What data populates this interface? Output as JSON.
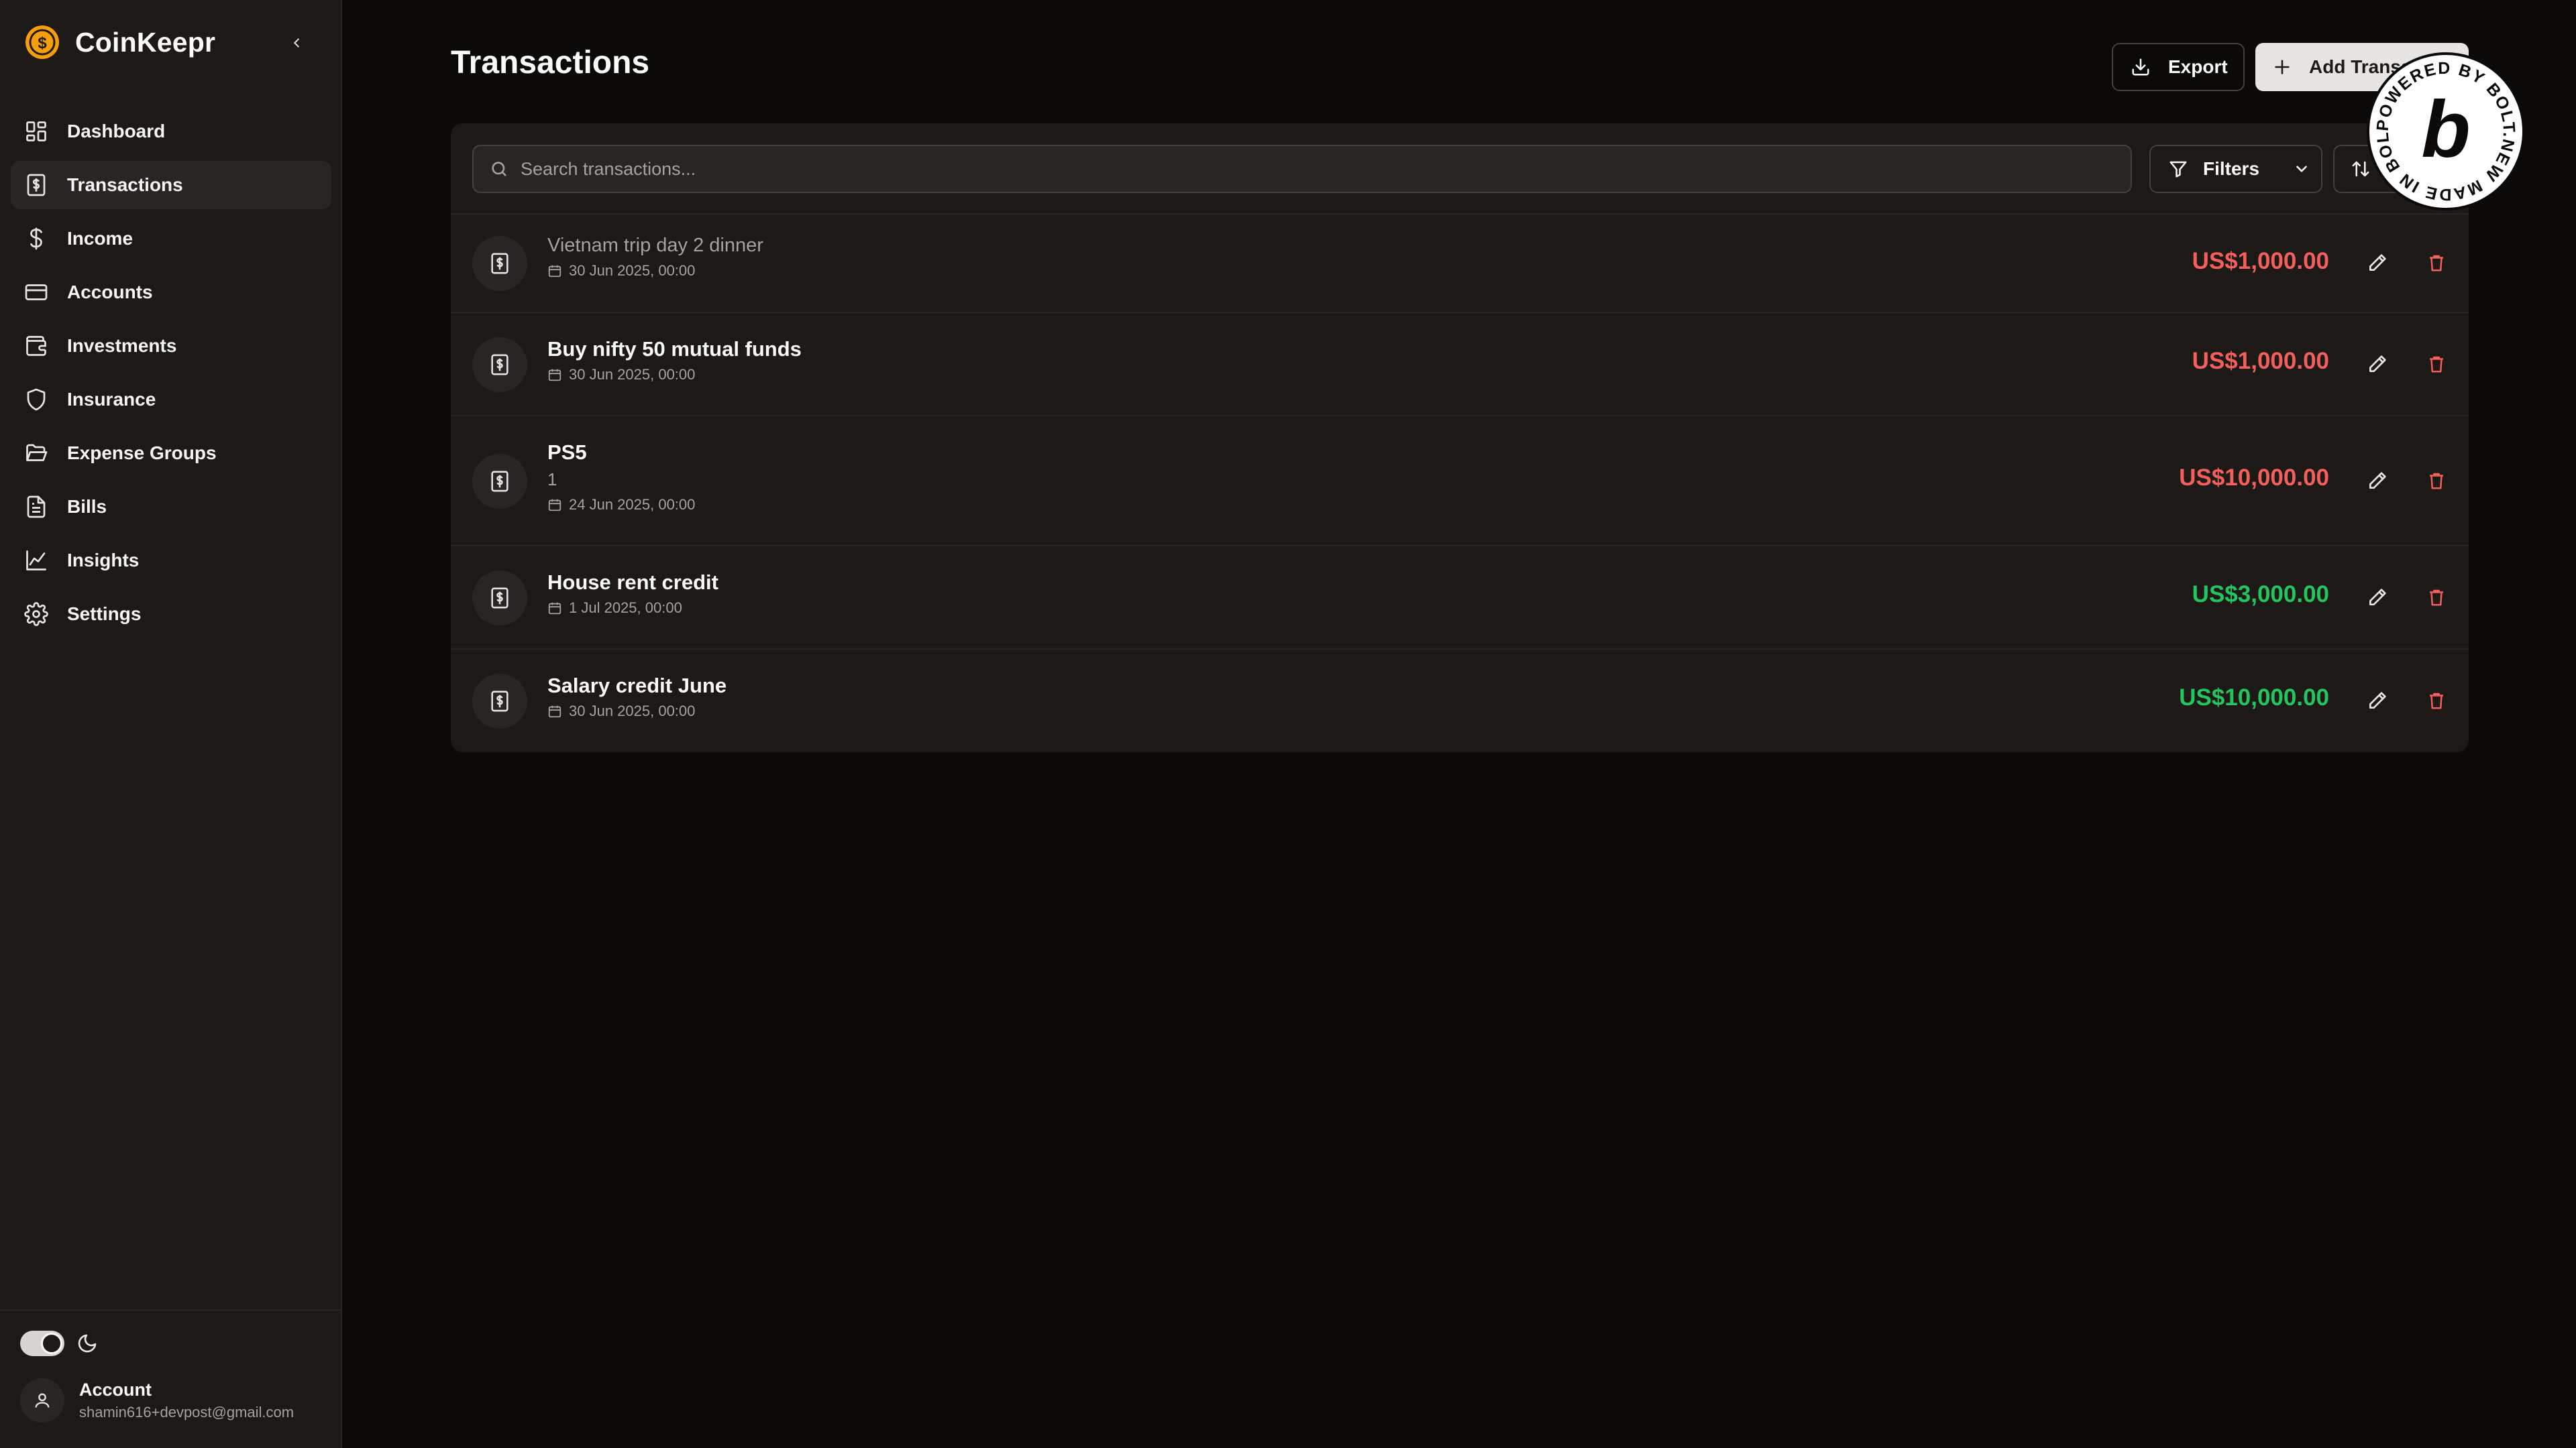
{
  "app": {
    "name": "CoinKeepr"
  },
  "sidebar": {
    "items": [
      {
        "label": "Dashboard",
        "icon": "dashboard-icon",
        "active": false
      },
      {
        "label": "Transactions",
        "icon": "receipt-dollar-icon",
        "active": true
      },
      {
        "label": "Income",
        "icon": "dollar-sign-icon",
        "active": false
      },
      {
        "label": "Accounts",
        "icon": "credit-card-icon",
        "active": false
      },
      {
        "label": "Investments",
        "icon": "wallet-icon",
        "active": false
      },
      {
        "label": "Insurance",
        "icon": "shield-icon",
        "active": false
      },
      {
        "label": "Expense Groups",
        "icon": "folder-open-icon",
        "active": false
      },
      {
        "label": "Bills",
        "icon": "file-text-icon",
        "active": false
      },
      {
        "label": "Insights",
        "icon": "line-chart-icon",
        "active": false
      },
      {
        "label": "Settings",
        "icon": "gear-icon",
        "active": false
      }
    ],
    "account": {
      "name": "Account",
      "email": "shamin616+devpost@gmail.com"
    },
    "theme": "dark"
  },
  "header": {
    "title": "Transactions",
    "export_label": "Export",
    "add_label": "Add Transaction"
  },
  "toolbar": {
    "search_placeholder": "Search transactions...",
    "filters_label": "Filters"
  },
  "transactions": [
    {
      "title": "Vietnam trip day 2 dinner",
      "note": "",
      "date": "30 Jun 2025, 00:00",
      "amount": "US$1,000.00",
      "type": "debit",
      "muted": true
    },
    {
      "title": "Buy nifty 50 mutual funds",
      "note": "",
      "date": "30 Jun 2025, 00:00",
      "amount": "US$1,000.00",
      "type": "debit",
      "muted": false
    },
    {
      "title": "PS5",
      "note": "1",
      "date": "24 Jun 2025, 00:00",
      "amount": "US$10,000.00",
      "type": "debit",
      "muted": false
    },
    {
      "title": "House rent credit",
      "note": "",
      "date": "1 Jul 2025, 00:00",
      "amount": "US$3,000.00",
      "type": "credit",
      "muted": false
    },
    {
      "title": "Salary credit June",
      "note": "",
      "date": "30 Jun 2025, 00:00",
      "amount": "US$10,000.00",
      "type": "credit",
      "muted": false
    }
  ],
  "colors": {
    "debit": "#f25f5c",
    "credit": "#22c55e",
    "brand": "#f59e0b"
  },
  "badge": {
    "text": "POWERED BY BOLT.NEW MADE IN BOLT.NEW",
    "letter": "b"
  }
}
